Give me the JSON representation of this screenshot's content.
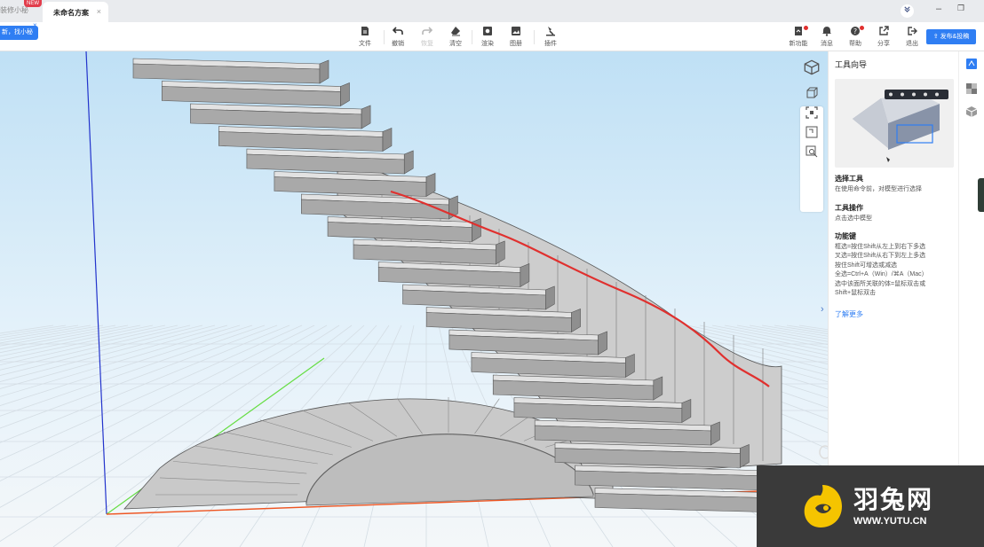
{
  "tabs": {
    "previous": "装修小秘",
    "new_badge": "NEW",
    "active": "未命名方案",
    "close_glyph": "×"
  },
  "window": {
    "minimize": "–",
    "restore": "❐"
  },
  "tooltip_tag": {
    "text": "新，找小秘",
    "close_glyph": "×"
  },
  "toolbar": {
    "left_tools": [
      {
        "label": "文件",
        "icon": "file-icon"
      },
      {
        "label": "撤销",
        "icon": "undo-icon"
      },
      {
        "label": "恢复",
        "icon": "redo-icon"
      },
      {
        "label": "清空",
        "icon": "eraser-icon"
      },
      {
        "label": "渲染",
        "icon": "render-icon"
      },
      {
        "label": "图册",
        "icon": "album-icon"
      },
      {
        "label": "插件",
        "icon": "plugin-icon"
      }
    ],
    "right_tools": [
      {
        "label": "新功能",
        "icon": "new-feature-icon"
      },
      {
        "label": "消息",
        "icon": "bell-icon"
      },
      {
        "label": "帮助",
        "icon": "help-icon"
      },
      {
        "label": "分享",
        "icon": "share-icon"
      },
      {
        "label": "退出",
        "icon": "exit-icon"
      }
    ],
    "publish_label": "发布&投稿"
  },
  "panel": {
    "title": "工具向导",
    "section1_title": "选择工具",
    "section1_text": "在使用命令前，对模型进行选择",
    "section2_title": "工具操作",
    "section2_text": "点击选中模型",
    "section3_title": "功能键",
    "section3_lines": [
      "框选=按住Shift从左上到右下多选",
      "叉选=按住Shift从右下到左上多选",
      "按住Shift可增选或减选",
      "全选=Ctrl+A（Win）/⌘A（Mac）",
      "选中该面所关联的体=鼠标双击或",
      "Shift+鼠标双击"
    ],
    "learn_more": "了解更多"
  },
  "watermark": {
    "brand": "羽兔网",
    "url": "WWW.YUTU.CN"
  },
  "colors": {
    "accent": "#2f7ef3",
    "notify": "#e0302e",
    "handrail": "#e0302e"
  }
}
